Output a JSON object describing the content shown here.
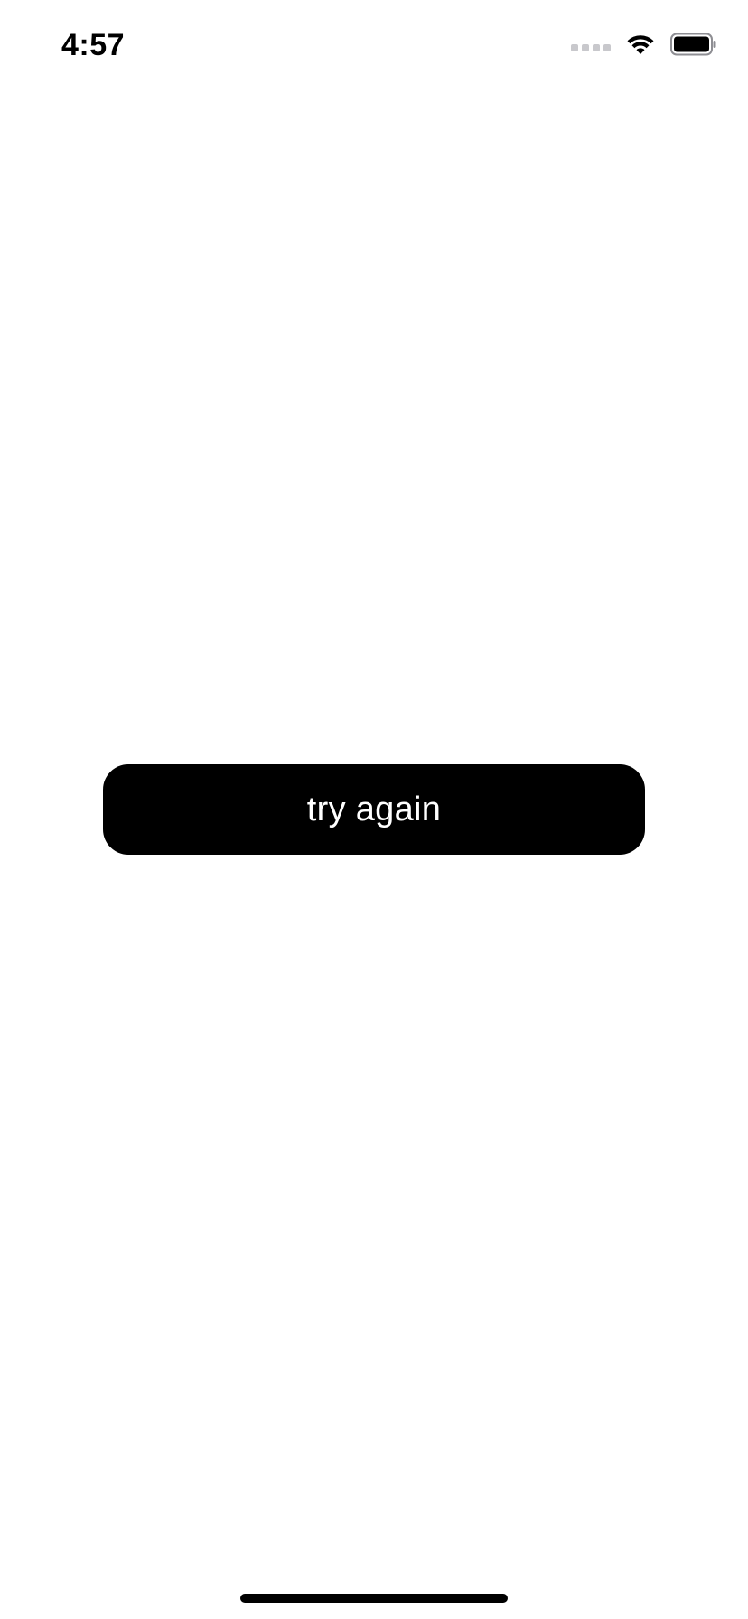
{
  "status_bar": {
    "time": "4:57",
    "signal_icon": "cellular-signal-icon",
    "wifi_icon": "wifi-icon",
    "battery_icon": "battery-icon",
    "battery_level": 1.0
  },
  "main": {
    "try_again_label": "try again"
  },
  "colors": {
    "background": "#ffffff",
    "button_background": "#000000",
    "button_text": "#ffffff",
    "signal_inactive": "#c8c8cc"
  }
}
